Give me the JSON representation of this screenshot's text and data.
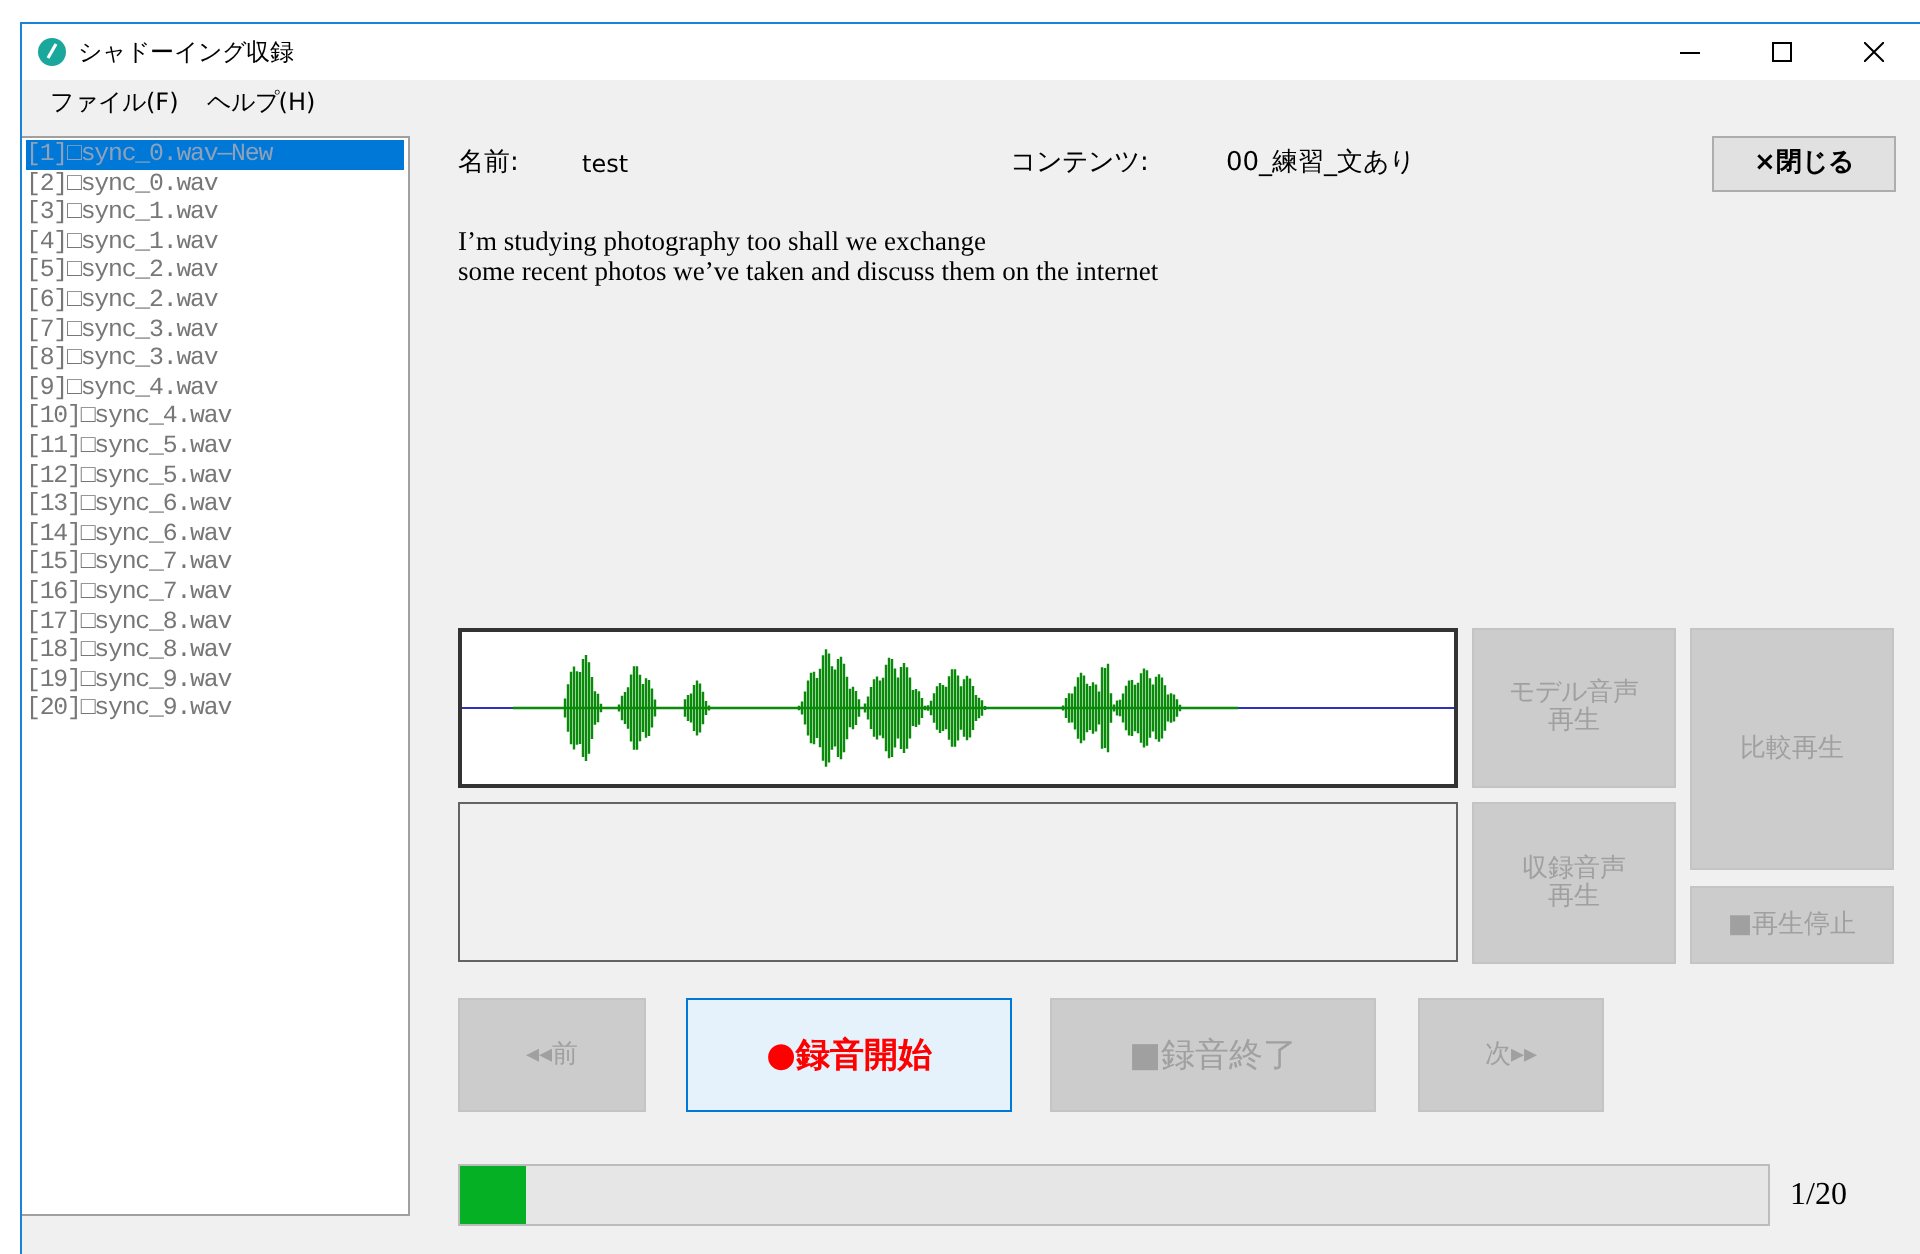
{
  "window": {
    "title": "シャドーイング収録"
  },
  "menu": [
    "ファイル(F)",
    "ヘルプ(H)"
  ],
  "files": [
    {
      "label": "[1]□sync_0.wav—New",
      "selected": true
    },
    {
      "label": "[2]□sync_0.wav",
      "selected": false
    },
    {
      "label": "[3]□sync_1.wav",
      "selected": false
    },
    {
      "label": "[4]□sync_1.wav",
      "selected": false
    },
    {
      "label": "[5]□sync_2.wav",
      "selected": false
    },
    {
      "label": "[6]□sync_2.wav",
      "selected": false
    },
    {
      "label": "[7]□sync_3.wav",
      "selected": false
    },
    {
      "label": "[8]□sync_3.wav",
      "selected": false
    },
    {
      "label": "[9]□sync_4.wav",
      "selected": false
    },
    {
      "label": "[10]□sync_4.wav",
      "selected": false
    },
    {
      "label": "[11]□sync_5.wav",
      "selected": false
    },
    {
      "label": "[12]□sync_5.wav",
      "selected": false
    },
    {
      "label": "[13]□sync_6.wav",
      "selected": false
    },
    {
      "label": "[14]□sync_6.wav",
      "selected": false
    },
    {
      "label": "[15]□sync_7.wav",
      "selected": false
    },
    {
      "label": "[16]□sync_7.wav",
      "selected": false
    },
    {
      "label": "[17]□sync_8.wav",
      "selected": false
    },
    {
      "label": "[18]□sync_8.wav",
      "selected": false
    },
    {
      "label": "[19]□sync_9.wav",
      "selected": false
    },
    {
      "label": "[20]□sync_9.wav",
      "selected": false
    }
  ],
  "header": {
    "name_label": "名前:",
    "name_value": "test",
    "content_label": "コンテンツ:",
    "content_value": "00_練習_文あり",
    "close_button": "×閉じる"
  },
  "sentence": [
    "I’m studying photography too shall we exchange",
    "some recent photos we’ve taken and discuss them on the internet"
  ],
  "playback_buttons": {
    "model": {
      "lines": [
        "モデル音声",
        "再生"
      ],
      "disabled": true
    },
    "recorded": {
      "lines": [
        "収録音声",
        "再生"
      ],
      "disabled": true
    },
    "compare": {
      "lines": [
        "比較再生"
      ],
      "disabled": true
    },
    "stop": {
      "icon": "■",
      "label": "再生停止",
      "disabled": true
    }
  },
  "record_buttons": [
    {
      "label": "◂◂前",
      "disabled": true
    },
    {
      "icon": "●",
      "label": "録音開始",
      "disabled": false
    },
    {
      "icon": "■",
      "label": "録音終了",
      "disabled": true
    },
    {
      "label": "次▸▸",
      "disabled": true
    }
  ],
  "progress": {
    "level": 0.05,
    "reading": "1/20"
  }
}
